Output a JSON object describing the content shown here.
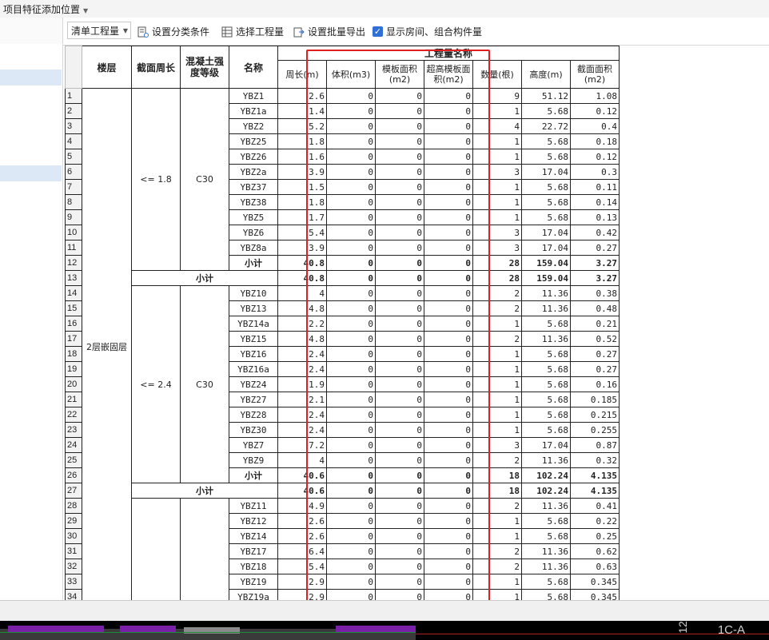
{
  "topbar": {
    "menu_label": "项目特征添加位置"
  },
  "toolbar": {
    "select_value": "清单工程量",
    "btn_classify": "设置分类条件",
    "btn_select_qty": "选择工程量",
    "btn_batch_export": "设置批量导出",
    "chk_show_rooms": "显示房间、组合构件量"
  },
  "table": {
    "headers": {
      "floor": "楼层",
      "perimeter_range": "截面周长",
      "concrete_grade": "混凝土强度等级",
      "name": "名称",
      "group": "工程量名称",
      "perimeter": "周长(m)",
      "volume": "体积(m3)",
      "formwork": "模板面积(m2)",
      "high_formwork": "超高模板面积(m2)",
      "count": "数量(根)",
      "height": "高度(m)",
      "section_area": "截面面积(m2)"
    },
    "floor_label": "2层嵌固层",
    "group1": {
      "range": "<= 1.8",
      "grade": "C30"
    },
    "group2": {
      "range": "<= 2.4",
      "grade": "C30"
    },
    "subtotal_label": "小计",
    "rows": [
      {
        "n": "1",
        "name": "YBZ1",
        "p": "2.6",
        "v": "0",
        "f": "0",
        "h": "0",
        "c": "9",
        "ht": "51.12",
        "a": "1.08"
      },
      {
        "n": "2",
        "name": "YBZ1a",
        "p": "1.4",
        "v": "0",
        "f": "0",
        "h": "0",
        "c": "1",
        "ht": "5.68",
        "a": "0.12"
      },
      {
        "n": "3",
        "name": "YBZ2",
        "p": "5.2",
        "v": "0",
        "f": "0",
        "h": "0",
        "c": "4",
        "ht": "22.72",
        "a": "0.4"
      },
      {
        "n": "4",
        "name": "YBZ25",
        "p": "1.8",
        "v": "0",
        "f": "0",
        "h": "0",
        "c": "1",
        "ht": "5.68",
        "a": "0.18"
      },
      {
        "n": "5",
        "name": "YBZ26",
        "p": "1.6",
        "v": "0",
        "f": "0",
        "h": "0",
        "c": "1",
        "ht": "5.68",
        "a": "0.12"
      },
      {
        "n": "6",
        "name": "YBZ2a",
        "p": "3.9",
        "v": "0",
        "f": "0",
        "h": "0",
        "c": "3",
        "ht": "17.04",
        "a": "0.3"
      },
      {
        "n": "7",
        "name": "YBZ37",
        "p": "1.5",
        "v": "0",
        "f": "0",
        "h": "0",
        "c": "1",
        "ht": "5.68",
        "a": "0.11"
      },
      {
        "n": "8",
        "name": "YBZ38",
        "p": "1.8",
        "v": "0",
        "f": "0",
        "h": "0",
        "c": "1",
        "ht": "5.68",
        "a": "0.14"
      },
      {
        "n": "9",
        "name": "YBZ5",
        "p": "1.7",
        "v": "0",
        "f": "0",
        "h": "0",
        "c": "1",
        "ht": "5.68",
        "a": "0.13"
      },
      {
        "n": "10",
        "name": "YBZ6",
        "p": "5.4",
        "v": "0",
        "f": "0",
        "h": "0",
        "c": "3",
        "ht": "17.04",
        "a": "0.42"
      },
      {
        "n": "11",
        "name": "YBZ8a",
        "p": "3.9",
        "v": "0",
        "f": "0",
        "h": "0",
        "c": "3",
        "ht": "17.04",
        "a": "0.27"
      },
      {
        "n": "12",
        "name": "小计",
        "p": "40.8",
        "v": "0",
        "f": "0",
        "h": "0",
        "c": "28",
        "ht": "159.04",
        "a": "3.27"
      },
      {
        "n": "13",
        "name": "小计",
        "p": "40.8",
        "v": "0",
        "f": "0",
        "h": "0",
        "c": "28",
        "ht": "159.04",
        "a": "3.27"
      },
      {
        "n": "14",
        "name": "YBZ10",
        "p": "4",
        "v": "0",
        "f": "0",
        "h": "0",
        "c": "2",
        "ht": "11.36",
        "a": "0.38"
      },
      {
        "n": "15",
        "name": "YBZ13",
        "p": "4.8",
        "v": "0",
        "f": "0",
        "h": "0",
        "c": "2",
        "ht": "11.36",
        "a": "0.48"
      },
      {
        "n": "16",
        "name": "YBZ14a",
        "p": "2.2",
        "v": "0",
        "f": "0",
        "h": "0",
        "c": "1",
        "ht": "5.68",
        "a": "0.21"
      },
      {
        "n": "17",
        "name": "YBZ15",
        "p": "4.8",
        "v": "0",
        "f": "0",
        "h": "0",
        "c": "2",
        "ht": "11.36",
        "a": "0.52"
      },
      {
        "n": "18",
        "name": "YBZ16",
        "p": "2.4",
        "v": "0",
        "f": "0",
        "h": "0",
        "c": "1",
        "ht": "5.68",
        "a": "0.27"
      },
      {
        "n": "19",
        "name": "YBZ16a",
        "p": "2.4",
        "v": "0",
        "f": "0",
        "h": "0",
        "c": "1",
        "ht": "5.68",
        "a": "0.27"
      },
      {
        "n": "20",
        "name": "YBZ24",
        "p": "1.9",
        "v": "0",
        "f": "0",
        "h": "0",
        "c": "1",
        "ht": "5.68",
        "a": "0.16"
      },
      {
        "n": "21",
        "name": "YBZ27",
        "p": "2.1",
        "v": "0",
        "f": "0",
        "h": "0",
        "c": "1",
        "ht": "5.68",
        "a": "0.185"
      },
      {
        "n": "22",
        "name": "YBZ28",
        "p": "2.4",
        "v": "0",
        "f": "0",
        "h": "0",
        "c": "1",
        "ht": "5.68",
        "a": "0.215"
      },
      {
        "n": "23",
        "name": "YBZ30",
        "p": "2.4",
        "v": "0",
        "f": "0",
        "h": "0",
        "c": "1",
        "ht": "5.68",
        "a": "0.255"
      },
      {
        "n": "24",
        "name": "YBZ7",
        "p": "7.2",
        "v": "0",
        "f": "0",
        "h": "0",
        "c": "3",
        "ht": "17.04",
        "a": "0.87"
      },
      {
        "n": "25",
        "name": "YBZ9",
        "p": "4",
        "v": "0",
        "f": "0",
        "h": "0",
        "c": "2",
        "ht": "11.36",
        "a": "0.32"
      },
      {
        "n": "26",
        "name": "小计",
        "p": "40.6",
        "v": "0",
        "f": "0",
        "h": "0",
        "c": "18",
        "ht": "102.24",
        "a": "4.135"
      },
      {
        "n": "27",
        "name": "小计",
        "p": "40.6",
        "v": "0",
        "f": "0",
        "h": "0",
        "c": "18",
        "ht": "102.24",
        "a": "4.135"
      },
      {
        "n": "28",
        "name": "YBZ11",
        "p": "4.9",
        "v": "0",
        "f": "0",
        "h": "0",
        "c": "2",
        "ht": "11.36",
        "a": "0.41"
      },
      {
        "n": "29",
        "name": "YBZ12",
        "p": "2.6",
        "v": "0",
        "f": "0",
        "h": "0",
        "c": "1",
        "ht": "5.68",
        "a": "0.22"
      },
      {
        "n": "30",
        "name": "YBZ14",
        "p": "2.6",
        "v": "0",
        "f": "0",
        "h": "0",
        "c": "1",
        "ht": "5.68",
        "a": "0.25"
      },
      {
        "n": "31",
        "name": "YBZ17",
        "p": "6.4",
        "v": "0",
        "f": "0",
        "h": "0",
        "c": "2",
        "ht": "11.36",
        "a": "0.62"
      },
      {
        "n": "32",
        "name": "YBZ18",
        "p": "5.4",
        "v": "0",
        "f": "0",
        "h": "0",
        "c": "2",
        "ht": "11.36",
        "a": "0.63"
      },
      {
        "n": "33",
        "name": "YBZ19",
        "p": "2.9",
        "v": "0",
        "f": "0",
        "h": "0",
        "c": "1",
        "ht": "5.68",
        "a": "0.345"
      },
      {
        "n": "34",
        "name": "YBZ19a",
        "p": "2.9",
        "v": "0",
        "f": "0",
        "h": "0",
        "c": "1",
        "ht": "5.68",
        "a": "0.345"
      }
    ]
  },
  "cad": {
    "label_a": "1C-A",
    "label_b": "12"
  },
  "colors": {
    "highlight_box": "#e02020",
    "selection": "#dde8f6",
    "accent": "#2f6fd6"
  }
}
